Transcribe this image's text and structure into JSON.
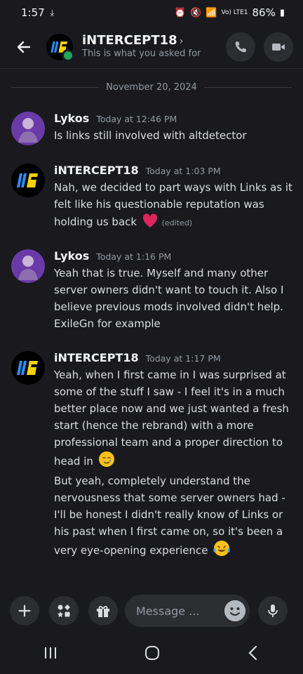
{
  "status": {
    "time": "1:57",
    "battery": "86%",
    "network": "Vo) LTE1"
  },
  "header": {
    "title": "iNTERCEPT18",
    "subtitle": "This is what you asked for"
  },
  "date_divider": "November 20, 2024",
  "messages": [
    {
      "author": "Lykos",
      "timestamp": "Today at 12:46 PM",
      "lines": [
        "Is links still involved with altdetector"
      ]
    },
    {
      "author": "iNTERCEPT18",
      "timestamp": "Today at 1:03 PM",
      "lines": [
        "Nah, we decided to part ways with Links as it felt like his questionable reputation was holding us back"
      ],
      "edited_label": "(edited)"
    },
    {
      "author": "Lykos",
      "timestamp": "Today at 1:16 PM",
      "lines": [
        "Yeah that is true. Myself and many other server owners didn't want to touch it. Also I believe previous mods involved didn't help. ExileGn for example"
      ]
    },
    {
      "author": "iNTERCEPT18",
      "timestamp": "Today at 1:17 PM",
      "lines": [
        "Yeah, when I first came in I was surprised at some of the stuff I saw - I feel it's in a much better place now and we just wanted a fresh start (hence the rebrand) with a more professional team and a proper direction to head in",
        "But yeah, completely understand the nervousness that some server owners had - I'll be honest I didn't really know of Links or his past when I first came on, so it's been a very eye-opening experience"
      ]
    }
  ],
  "composer": {
    "placeholder": "Message ..."
  },
  "icons": {
    "back": "arrow-left-icon",
    "call": "phone-icon",
    "video": "video-camera-icon",
    "add": "plus-icon",
    "apps": "apps-icon",
    "gift": "gift-icon",
    "emoji": "emoji-icon",
    "mic": "microphone-icon",
    "heart": "red-heart-emoji",
    "tear": "smiling-tear-emoji",
    "laugh": "tears-of-joy-emoji"
  },
  "colors": {
    "background": "#1a1a1e",
    "online": "#23a55a",
    "heart": "#e0245e"
  }
}
